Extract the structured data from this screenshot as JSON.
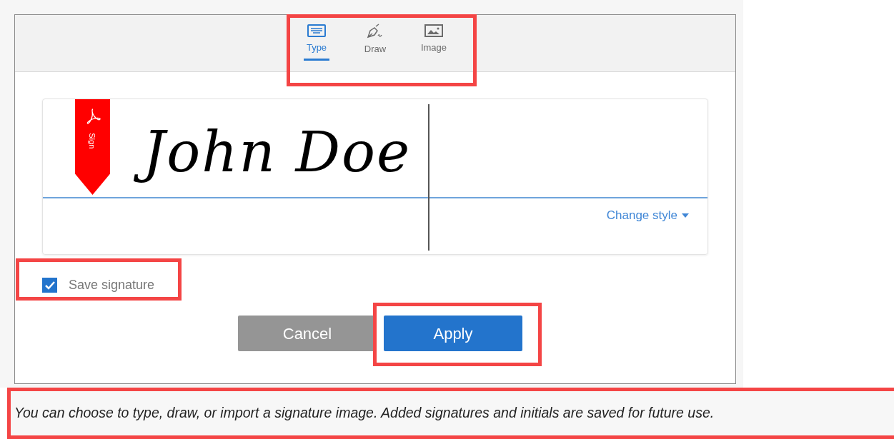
{
  "tabs": [
    {
      "label": "Type",
      "kind": "keyboard",
      "selected": true
    },
    {
      "label": "Draw",
      "kind": "pen",
      "selected": false
    },
    {
      "label": "Image",
      "kind": "picture",
      "selected": false
    }
  ],
  "ribbon": {
    "label": "Sign"
  },
  "signature": {
    "value": "John Doe"
  },
  "change_style": {
    "label": "Change style"
  },
  "save_signature": {
    "label": "Save signature",
    "checked": true
  },
  "buttons": [
    {
      "label": "Cancel",
      "kind": "secondary"
    },
    {
      "label": "Apply",
      "kind": "primary"
    }
  ],
  "footer_note": "You can choose to type, draw, or import a signature image. Added signatures and initials are saved for future use."
}
